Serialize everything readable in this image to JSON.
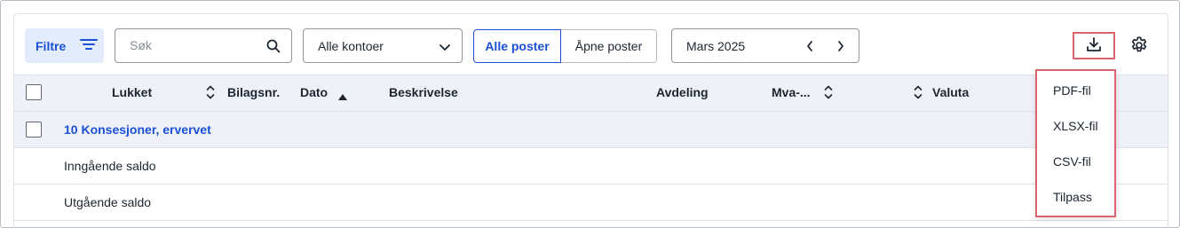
{
  "toolbar": {
    "filter_label": "Filtre",
    "search_placeholder": "Søk",
    "account_select": "Alle kontoer",
    "segment_all": "Alle poster",
    "segment_open": "Åpne poster",
    "period": "Mars 2025"
  },
  "table": {
    "columns": [
      "Lukket",
      "Bilagsnr.",
      "Dato",
      "Beskrivelse",
      "Avdeling",
      "Mva-...",
      "Valuta"
    ],
    "group": "10 Konsesjoner, ervervet",
    "rows": [
      "Inngående saldo",
      "Utgående saldo"
    ]
  },
  "export_menu": {
    "items": [
      "PDF-fil",
      "XLSX-fil",
      "CSV-fil",
      "Tilpass"
    ]
  },
  "colors": {
    "accent": "#1a4fd6",
    "highlight_border": "#d9646e",
    "header_bg": "#eef1f8"
  },
  "icons": [
    "filter-icon",
    "search-icon",
    "chevron-down-icon",
    "chevron-left-icon",
    "chevron-right-icon",
    "download-icon",
    "gear-icon",
    "sort-icon",
    "sort-asc-icon"
  ]
}
